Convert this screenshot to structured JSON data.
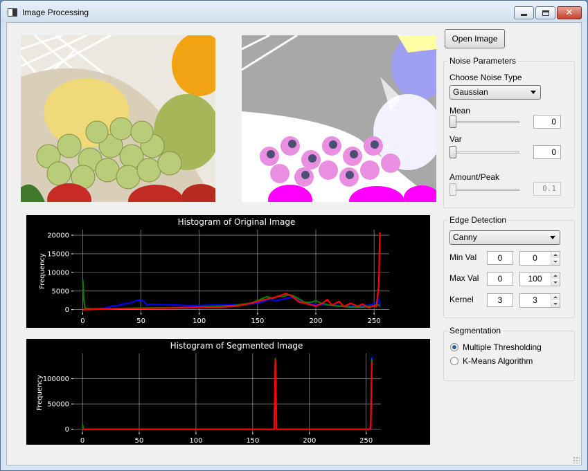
{
  "window": {
    "title": "Image Processing"
  },
  "toolbar": {
    "open_image_label": "Open Image"
  },
  "noise": {
    "group_title": "Noise Parameters",
    "type_label": "Choose Noise Type",
    "type_value": "Gaussian",
    "mean_label": "Mean",
    "mean_value": "0",
    "var_label": "Var",
    "var_value": "0",
    "amount_label": "Amount/Peak",
    "amount_value": "0.1"
  },
  "edge": {
    "group_title": "Edge Detection",
    "method_value": "Canny",
    "min_label": "Min Val",
    "min_value": "0",
    "min_spin": "0",
    "max_label": "Max Val",
    "max_value": "0",
    "max_spin": "100",
    "kernel_label": "Kernel",
    "kernel_value": "3",
    "kernel_spin": "3"
  },
  "segmentation": {
    "group_title": "Segmentation",
    "options": [
      {
        "label": "Multiple Thresholding",
        "checked": true
      },
      {
        "label": "K-Means Algorithm",
        "checked": false
      }
    ]
  },
  "colors": {
    "red": "#ff0000",
    "green": "#008000",
    "blue": "#0000ff",
    "grid": "#b0b0b0",
    "text": "#ffffff"
  },
  "chart_data": [
    {
      "type": "line",
      "title": "Histogram of Original Image",
      "xlabel": "",
      "ylabel": "Frequency",
      "xlim": [
        -8,
        263
      ],
      "ylim": [
        -800,
        21500
      ],
      "xticks": [
        0,
        50,
        100,
        150,
        200,
        250
      ],
      "yticks": [
        0,
        5000,
        10000,
        15000,
        20000
      ],
      "grid": true,
      "series": [
        {
          "color": "#0000ff",
          "points": [
            [
              0,
              0
            ],
            [
              10,
              200
            ],
            [
              20,
              400
            ],
            [
              25,
              1000
            ],
            [
              30,
              1100
            ],
            [
              35,
              1500
            ],
            [
              40,
              1700
            ],
            [
              45,
              2300
            ],
            [
              48,
              2600
            ],
            [
              52,
              2300
            ],
            [
              55,
              1300
            ],
            [
              60,
              1400
            ],
            [
              70,
              1300
            ],
            [
              80,
              1200
            ],
            [
              90,
              1100
            ],
            [
              100,
              1100
            ],
            [
              110,
              1200
            ],
            [
              120,
              1200
            ],
            [
              130,
              1300
            ],
            [
              140,
              1400
            ],
            [
              150,
              1800
            ],
            [
              155,
              2200
            ],
            [
              160,
              2800
            ],
            [
              165,
              2400
            ],
            [
              170,
              2700
            ],
            [
              175,
              3000
            ],
            [
              180,
              3400
            ],
            [
              185,
              2600
            ],
            [
              190,
              1700
            ],
            [
              200,
              1400
            ],
            [
              210,
              1200
            ],
            [
              220,
              1100
            ],
            [
              230,
              900
            ],
            [
              240,
              1000
            ],
            [
              248,
              1300
            ],
            [
              252,
              2000
            ],
            [
              254,
              3000
            ],
            [
              255,
              700
            ]
          ]
        },
        {
          "color": "#008000",
          "points": [
            [
              0,
              8000
            ],
            [
              1,
              2500
            ],
            [
              2,
              300
            ],
            [
              10,
              200
            ],
            [
              30,
              300
            ],
            [
              50,
              400
            ],
            [
              70,
              500
            ],
            [
              90,
              600
            ],
            [
              110,
              800
            ],
            [
              130,
              1100
            ],
            [
              145,
              1800
            ],
            [
              152,
              2700
            ],
            [
              158,
              3500
            ],
            [
              163,
              3000
            ],
            [
              168,
              3700
            ],
            [
              172,
              3500
            ],
            [
              176,
              4000
            ],
            [
              180,
              3800
            ],
            [
              185,
              3000
            ],
            [
              190,
              2000
            ],
            [
              195,
              1900
            ],
            [
              200,
              2400
            ],
            [
              205,
              1700
            ],
            [
              210,
              1300
            ],
            [
              220,
              900
            ],
            [
              230,
              700
            ],
            [
              240,
              700
            ],
            [
              248,
              900
            ],
            [
              253,
              1400
            ],
            [
              255,
              900
            ]
          ]
        },
        {
          "color": "#ff0000",
          "points": [
            [
              0,
              0
            ],
            [
              10,
              100
            ],
            [
              20,
              150
            ],
            [
              40,
              250
            ],
            [
              60,
              350
            ],
            [
              80,
              450
            ],
            [
              100,
              550
            ],
            [
              120,
              700
            ],
            [
              130,
              900
            ],
            [
              140,
              1400
            ],
            [
              148,
              2000
            ],
            [
              155,
              2600
            ],
            [
              160,
              3000
            ],
            [
              165,
              3300
            ],
            [
              170,
              3800
            ],
            [
              174,
              4300
            ],
            [
              178,
              3900
            ],
            [
              182,
              3000
            ],
            [
              186,
              2000
            ],
            [
              190,
              1800
            ],
            [
              195,
              1300
            ],
            [
              200,
              1000
            ],
            [
              205,
              1600
            ],
            [
              210,
              2700
            ],
            [
              214,
              1200
            ],
            [
              220,
              2200
            ],
            [
              224,
              800
            ],
            [
              230,
              1700
            ],
            [
              236,
              900
            ],
            [
              240,
              1500
            ],
            [
              245,
              600
            ],
            [
              250,
              1000
            ],
            [
              252,
              800
            ],
            [
              254,
              6500
            ],
            [
              255,
              20800
            ]
          ]
        }
      ]
    },
    {
      "type": "line",
      "title": "Histogram of Segmented Image",
      "xlabel": "",
      "ylabel": "Frequency",
      "xlim": [
        -8,
        263
      ],
      "ylim": [
        -6000,
        150000
      ],
      "xticks": [
        0,
        50,
        100,
        150,
        200,
        250
      ],
      "yticks": [
        0,
        50000,
        100000
      ],
      "grid": true,
      "series": [
        {
          "color": "#0000ff",
          "points": [
            [
              0,
              0
            ],
            [
              169,
              0
            ],
            [
              170,
              135000
            ],
            [
              171,
              0
            ],
            [
              253,
              0
            ],
            [
              254,
              6000
            ],
            [
              255,
              143000
            ]
          ]
        },
        {
          "color": "#008000",
          "points": [
            [
              0,
              10000
            ],
            [
              1,
              0
            ],
            [
              169,
              0
            ],
            [
              170,
              140000
            ],
            [
              171,
              0
            ],
            [
              253,
              0
            ],
            [
              254,
              4000
            ],
            [
              255,
              139000
            ]
          ]
        },
        {
          "color": "#ff0000",
          "points": [
            [
              0,
              0
            ],
            [
              169,
              0
            ],
            [
              170,
              137000
            ],
            [
              171,
              0
            ],
            [
              253,
              0
            ],
            [
              254,
              3000
            ],
            [
              255,
              132000
            ]
          ]
        }
      ]
    }
  ]
}
